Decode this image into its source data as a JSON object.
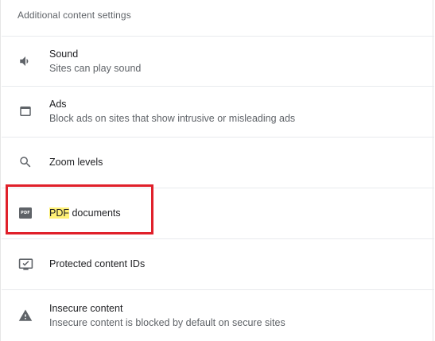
{
  "section_title": "Additional content settings",
  "items": [
    {
      "label": "Sound",
      "sublabel": "Sites can play sound",
      "icon": "speaker-icon"
    },
    {
      "label": "Ads",
      "sublabel": "Block ads on sites that show intrusive or misleading ads",
      "icon": "window-icon"
    },
    {
      "label": "Zoom levels",
      "sublabel": "",
      "icon": "search-icon"
    },
    {
      "label_highlight": "PDF",
      "label_rest": " documents",
      "icon": "pdf-icon",
      "icon_text": "PDF"
    },
    {
      "label": "Protected content IDs",
      "sublabel": "",
      "icon": "protected-content-icon"
    },
    {
      "label": "Insecure content",
      "sublabel": "Insecure content is blocked by default on secure sites",
      "icon": "warning-icon"
    }
  ],
  "colors": {
    "highlight": "#fff176",
    "annotation_border": "#e0202a",
    "icon": "#5f6368",
    "divider": "#e8eaed"
  }
}
